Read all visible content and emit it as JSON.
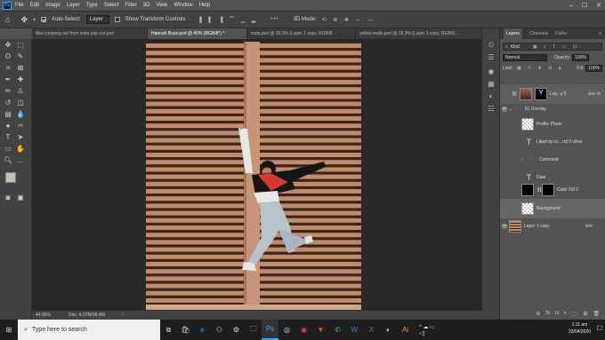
{
  "app": {
    "logo": "Ps"
  },
  "menu": [
    "File",
    "Edit",
    "Image",
    "Layer",
    "Type",
    "Select",
    "Filter",
    "3D",
    "View",
    "Window",
    "Help"
  ],
  "window_controls": {
    "minimize": "–",
    "maximize": "☐",
    "close": "✕"
  },
  "options_bar": {
    "auto_select_label": "Auto-Select:",
    "auto_select_value": "Layer",
    "transform_label": "Show Transform Controls",
    "three_d_mode": "3D Mode:"
  },
  "tabs": [
    {
      "label": "Man jumping out from insta pop out.psd"
    },
    {
      "label": "Hannah Buss.psd @ 45% (RGB/8*) *"
    },
    {
      "label": "insta.psd @ 33.3% (Layer 1 copy, RGB/8..."
    },
    {
      "label": "yellow walls.psd @ 33.3% (Layer 1 copy, RGB/8..."
    }
  ],
  "status": {
    "zoom": "44.96%",
    "doc": "Doc: 4.37M/38.4M"
  },
  "layers_panel": {
    "tabs": [
      "Layers",
      "Channels",
      "Paths"
    ],
    "kind_label": "Kind",
    "blend_mode": "Normal",
    "opacity_label": "Opacity:",
    "opacity_value": "100%",
    "lock_label": "Lock:",
    "fill_label": "Fill:",
    "fill_value": "100%",
    "layers": [
      {
        "name": "Lay...y 2"
      },
      {
        "name": "IG Overlay"
      },
      {
        "name": "Profile Photo"
      },
      {
        "name": "Liked by sc...nd 9 other"
      },
      {
        "name": "Comment"
      },
      {
        "name": "Date"
      },
      {
        "name": "Color Fill 2"
      },
      {
        "name": "Background"
      },
      {
        "name": "Layer 1 copy"
      }
    ],
    "fx_label": "fx"
  },
  "taskbar": {
    "search_placeholder": "Type here to search",
    "time": "1:11 am",
    "date": "23/04/2020"
  },
  "colors": {
    "accent": "#31a8ff",
    "photo_bg": "#c08a6e",
    "slat_dark": "#3b2418"
  }
}
